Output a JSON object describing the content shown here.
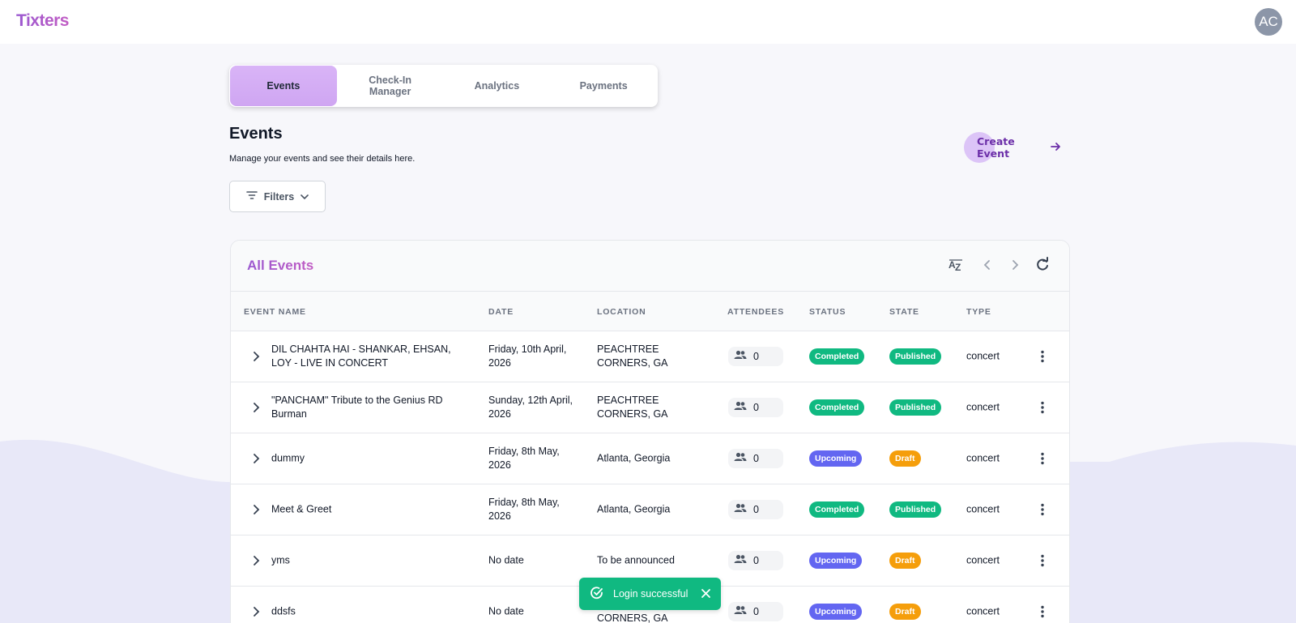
{
  "app": {
    "logo": "Tixters",
    "avatar_initials": "AC"
  },
  "tabs": [
    {
      "label": "Events",
      "active": true
    },
    {
      "label": "Check-In Manager",
      "active": false
    },
    {
      "label": "Analytics",
      "active": false
    },
    {
      "label": "Payments",
      "active": false
    }
  ],
  "page": {
    "title": "Events",
    "subtitle": "Manage your events and see their details here.",
    "create_label": "Create Event",
    "filters_label": "Filters"
  },
  "table": {
    "title": "All Events",
    "columns": [
      "EVENT NAME",
      "DATE",
      "LOCATION",
      "ATTENDEES",
      "STATUS",
      "STATE",
      "TYPE"
    ],
    "rows": [
      {
        "name": "DIL CHAHTA HAI - SHANKAR, EHSAN, LOY - LIVE IN CONCERT",
        "date": "Friday, 10th April, 2026",
        "location": "PEACHTREE CORNERS, GA",
        "attendees": "0",
        "status": "Completed",
        "state": "Published",
        "type": "concert"
      },
      {
        "name": "\"PANCHAM\" Tribute to the Genius RD Burman",
        "date": "Sunday, 12th April, 2026",
        "location": "PEACHTREE CORNERS, GA",
        "attendees": "0",
        "status": "Completed",
        "state": "Published",
        "type": "concert"
      },
      {
        "name": "dummy",
        "date": "Friday, 8th May, 2026",
        "location": "Atlanta, Georgia",
        "attendees": "0",
        "status": "Upcoming",
        "state": "Draft",
        "type": "concert"
      },
      {
        "name": "Meet & Greet",
        "date": "Friday, 8th May, 2026",
        "location": "Atlanta, Georgia",
        "attendees": "0",
        "status": "Completed",
        "state": "Published",
        "type": "concert"
      },
      {
        "name": "yms",
        "date": "No date",
        "location": "To be announced",
        "attendees": "0",
        "status": "Upcoming",
        "state": "Draft",
        "type": "concert"
      },
      {
        "name": "ddsfs",
        "date": "No date",
        "location": "PEACHTREE CORNERS, GA",
        "attendees": "0",
        "status": "Upcoming",
        "state": "Draft",
        "type": "concert"
      }
    ]
  },
  "toast": {
    "message": "Login successful"
  },
  "colors": {
    "completed": "#10b981",
    "published": "#10b981",
    "upcoming": "#6366f1",
    "draft": "#f59e0b",
    "accent": "#9b59d0"
  },
  "icons": [
    "sort-az-icon",
    "chevron-left-icon",
    "chevron-right-icon",
    "refresh-icon",
    "filter-icon",
    "chevron-down-icon",
    "users-icon",
    "more-vertical-icon",
    "check-circle-icon",
    "close-icon",
    "arrow-right-icon"
  ]
}
